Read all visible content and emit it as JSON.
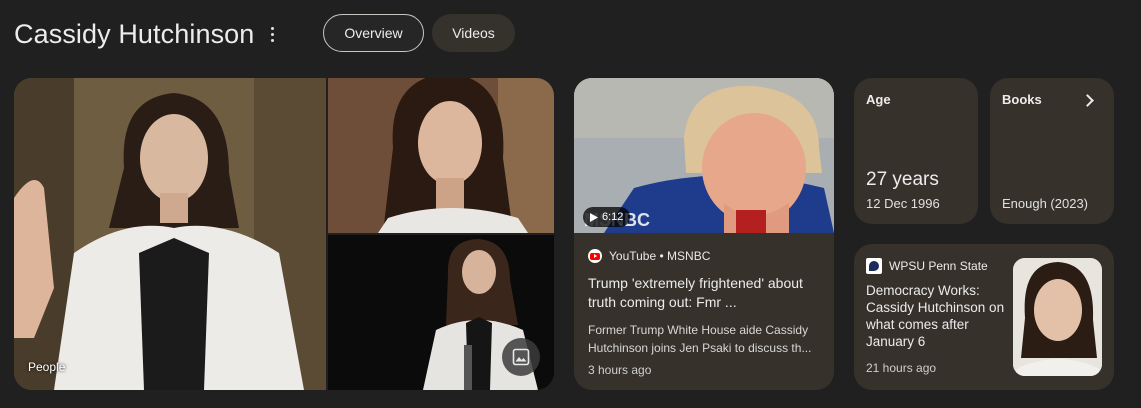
{
  "header": {
    "title": "Cassidy Hutchinson",
    "tabs": [
      {
        "label": "Overview",
        "selected": true
      },
      {
        "label": "Videos",
        "selected": false
      }
    ]
  },
  "photos": {
    "label": "People",
    "icon": "image-icon"
  },
  "video": {
    "duration": "6:12",
    "source": "YouTube • MSNBC",
    "title": "Trump 'extremely frightened' about truth coming out: Fmr ...",
    "description": "Former Trump White House aide Cassidy Hutchinson joins Jen Psaki to discuss th...",
    "time": "3 hours ago",
    "thumb_watermark": "MSNBC"
  },
  "age": {
    "label": "Age",
    "value": "27 years",
    "date": "12 Dec 1996"
  },
  "books": {
    "label": "Books",
    "value": "Enough (2023)"
  },
  "news": {
    "source": "WPSU Penn State",
    "title": "Democracy Works: Cassidy Hutchinson on what comes after January 6",
    "time": "21 hours ago"
  },
  "colors": {
    "background": "#202020",
    "card": "#36312a",
    "tab_active_border": "#c8c6c0",
    "tab_inactive": "#35322c",
    "youtube_red": "#ff0000"
  }
}
